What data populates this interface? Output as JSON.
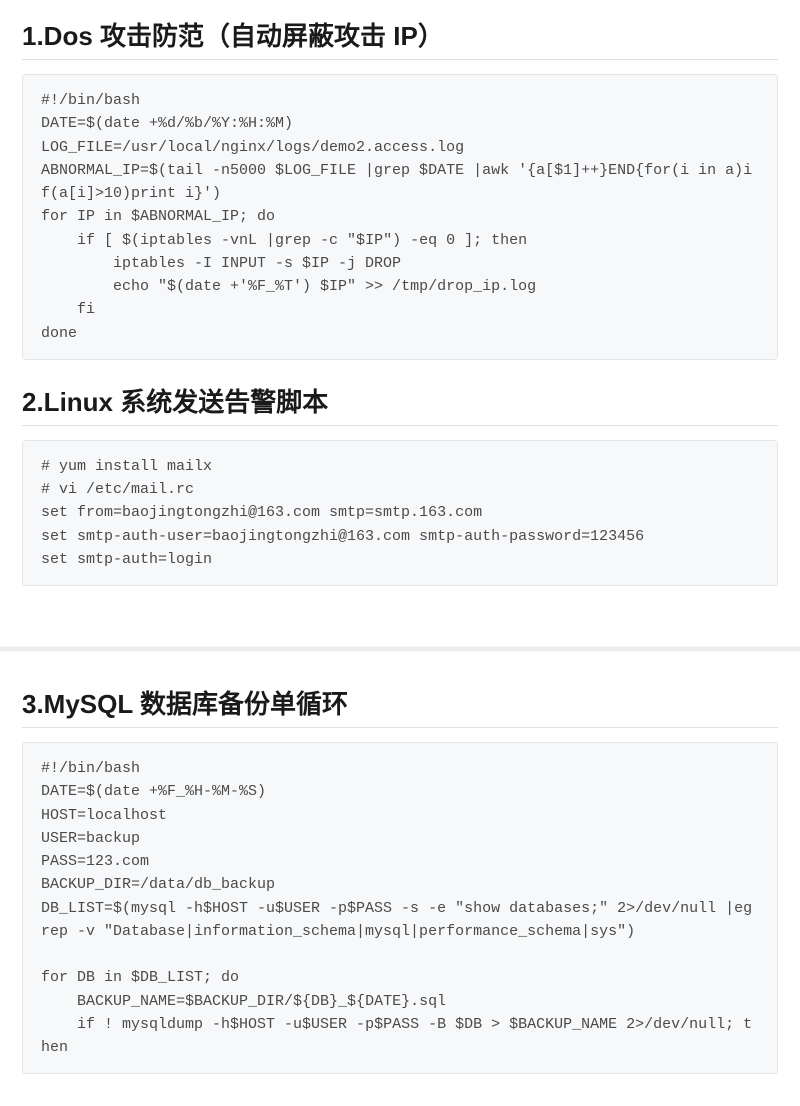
{
  "sections": [
    {
      "heading": "1.Dos 攻击防范（自动屏蔽攻击 IP）",
      "code": "#!/bin/bash\nDATE=$(date +%d/%b/%Y:%H:%M)\nLOG_FILE=/usr/local/nginx/logs/demo2.access.log\nABNORMAL_IP=$(tail -n5000 $LOG_FILE |grep $DATE |awk '{a[$1]++}END{for(i in a)if(a[i]>10)print i}')\nfor IP in $ABNORMAL_IP; do\n    if [ $(iptables -vnL |grep -c \"$IP\") -eq 0 ]; then\n        iptables -I INPUT -s $IP -j DROP\n        echo \"$(date +'%F_%T') $IP\" >> /tmp/drop_ip.log\n    fi\ndone"
    },
    {
      "heading": "2.Linux 系统发送告警脚本",
      "code": "# yum install mailx\n# vi /etc/mail.rc\nset from=baojingtongzhi@163.com smtp=smtp.163.com\nset smtp-auth-user=baojingtongzhi@163.com smtp-auth-password=123456\nset smtp-auth=login"
    },
    {
      "heading": "3.MySQL 数据库备份单循环",
      "code": "#!/bin/bash\nDATE=$(date +%F_%H-%M-%S)\nHOST=localhost\nUSER=backup\nPASS=123.com\nBACKUP_DIR=/data/db_backup\nDB_LIST=$(mysql -h$HOST -u$USER -p$PASS -s -e \"show databases;\" 2>/dev/null |egrep -v \"Database|information_schema|mysql|performance_schema|sys\")\n\nfor DB in $DB_LIST; do\n    BACKUP_NAME=$BACKUP_DIR/${DB}_${DATE}.sql\n    if ! mysqldump -h$HOST -u$USER -p$PASS -B $DB > $BACKUP_NAME 2>/dev/null; then"
    }
  ]
}
